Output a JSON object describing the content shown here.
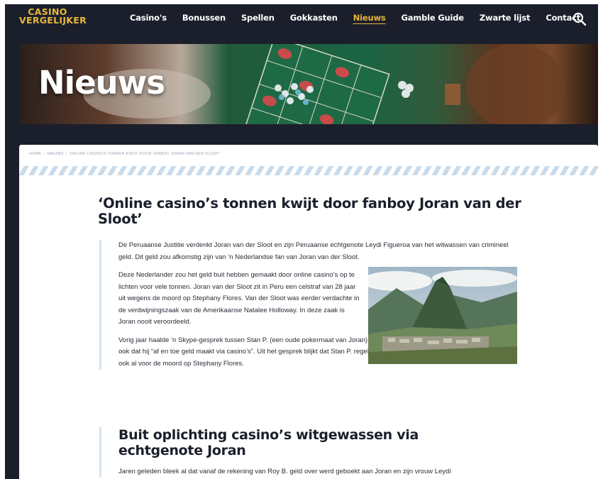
{
  "header": {
    "logo_line1": "CASINO",
    "logo_line2": "VERGELIJKER",
    "nav": [
      "Casino's",
      "Bonussen",
      "Spellen",
      "Gokkasten",
      "Nieuws",
      "Gamble Guide",
      "Zwarte lijst",
      "Contact"
    ],
    "active_nav": "Nieuws"
  },
  "hero": {
    "title": "Nieuws"
  },
  "breadcrumb": [
    "HOME",
    "›",
    "NIEUWS",
    "›",
    "'ONLINE CASINO'S TONNEN KWIJT DOOR FANBOY JORAN VAN DER SLOOT'"
  ],
  "article": {
    "title": "‘Online casino’s tonnen kwijt door fanboy Joran van der Sloot’",
    "p1": "De Peruaanse Justitie verdenkt Joran van der Sloot en zijn Peruaanse echtgenote Leydi Figueroa van het witwassen van crimineel geld. Dit geld zou afkomstig zijn van ‘n Nederlandse fan van Joran van der Sloot.",
    "p2": "Deze Nederlander zou het geld buit hebben gemaakt door online casino’s op te lichten voor vele tonnen. Joran van der Sloot zit in Peru een celstraf van 28 jaar uit wegens de moord op Stephany Flores. Van der Sloot was eerder verdachte in de verdwijningszaak van de Amerikaanse Natalee Holloway. In deze zaak is Joran nooit veroordeeld.",
    "p3": "Vorig jaar haalde ‘n Skype-gesprek tussen Stan P. (een oude pokermaat van Joran) en Joran nieuws. In dit gesprek meldt Stan P. ook dat hij “af en toe geld maakt via casino’s”. Uit het gesprek blijkt dat Stan P. regelmatig geld overmaakt aan Joran. Dat deed hij ook al voor de moord op Stephany Flores.",
    "subheading": "Buit oplichting casino’s witgewassen via echtgenote Joran",
    "p4": "Jaren geleden bleek al dat vanaf de rekening van Roy B. geld over werd geboekt aan Joran en zijn vrouw Leydi"
  },
  "colors": {
    "accent": "#e8b63a",
    "navy": "#1b1f2b",
    "stripe": "#c9dbea"
  },
  "icons": {
    "search": "search-icon"
  }
}
